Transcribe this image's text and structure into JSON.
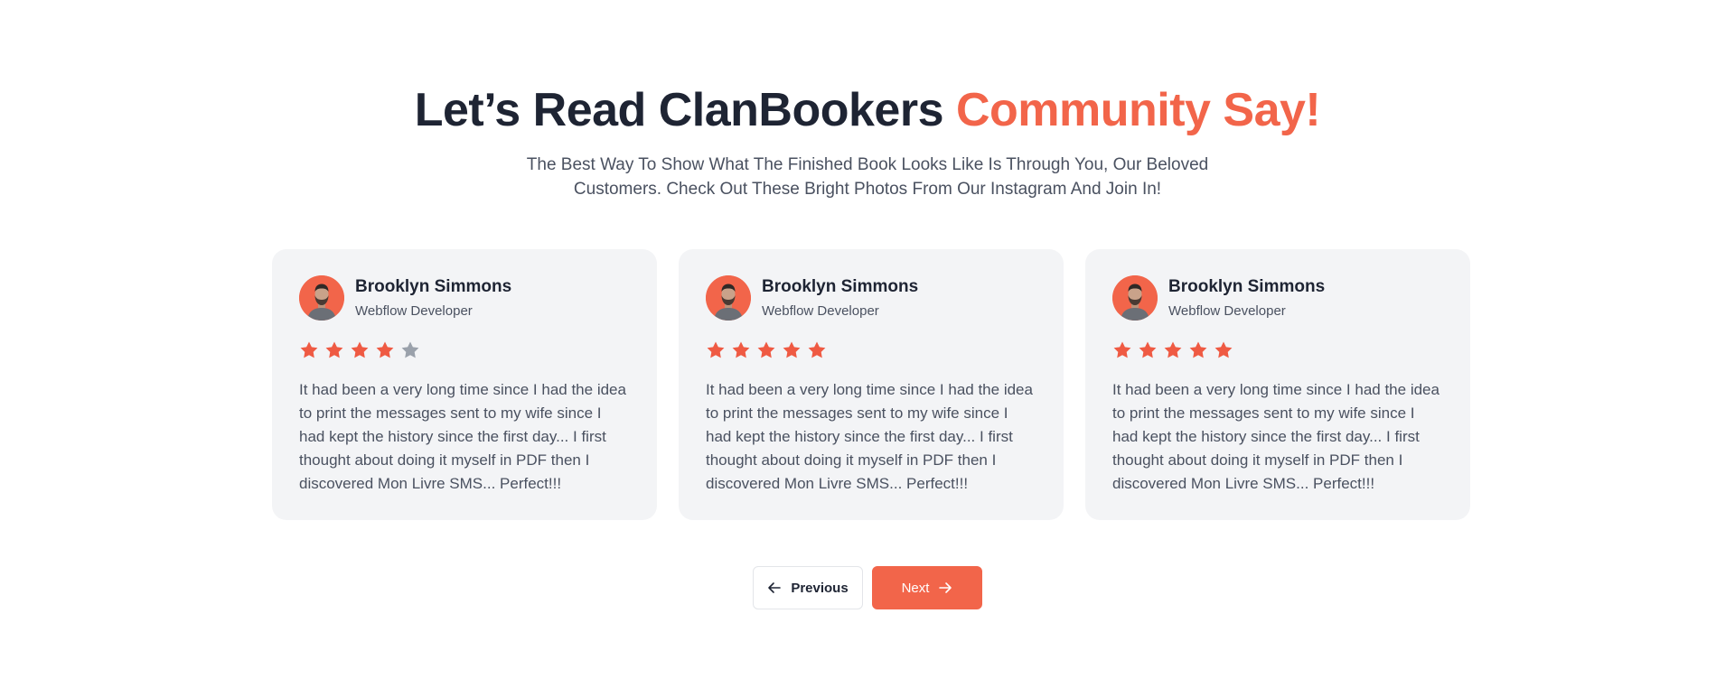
{
  "header": {
    "title_main": "Let’s Read ClanBookers ",
    "title_accent": "Community Say!",
    "subtitle": "The Best Way To Show What The Finished Book Looks Like Is Through You, Our Beloved Customers. Check Out These Bright Photos From Our Instagram And Join In!"
  },
  "testimonials": [
    {
      "name": "Brooklyn Simmons",
      "role": "Webflow Developer",
      "rating": 4,
      "max_rating": 5,
      "text": "It had been a very long time since I had the idea to print the messages sent to my wife since I had kept the history since the first day... I first thought about doing it myself in PDF then I discovered Mon Livre SMS... Perfect!!!"
    },
    {
      "name": "Brooklyn Simmons",
      "role": "Webflow Developer",
      "rating": 5,
      "max_rating": 5,
      "text": "It had been a very long time since I had the idea to print the messages sent to my wife since I had kept the history since the first day... I first thought about doing it myself in PDF then I discovered Mon Livre SMS... Perfect!!!"
    },
    {
      "name": "Brooklyn Simmons",
      "role": "Webflow Developer",
      "rating": 5,
      "max_rating": 5,
      "text": "It had been a very long time since I had the idea to print the messages sent to my wife since I had kept the history since the first day... I first thought about doing it myself in PDF then I discovered Mon Livre SMS... Perfect!!!"
    }
  ],
  "navigation": {
    "previous_label": "Previous",
    "next_label": "Next",
    "previous_icon": "arrow-left-icon",
    "next_icon": "arrow-right-icon"
  },
  "colors": {
    "accent": "#f2654a",
    "star_filled": "#ef5a43",
    "star_empty": "#9aa1ab",
    "card_bg": "#f3f4f6",
    "heading": "#1e2433",
    "body_text": "#4a5160"
  }
}
